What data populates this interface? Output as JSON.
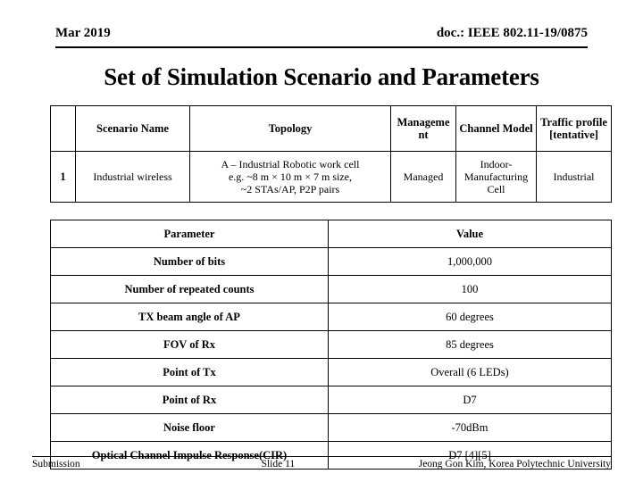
{
  "header": {
    "date": "Mar 2019",
    "doc": "doc.: IEEE 802.11-19/0875"
  },
  "title": "Set of Simulation Scenario and Parameters",
  "scenario_table": {
    "headers": [
      "",
      "Scenario Name",
      "Topology",
      "Manageme nt",
      "Channel Model",
      "Traffic profile [tentative]"
    ],
    "rows": [
      {
        "index": "1",
        "scenario_name": "Industrial wireless",
        "topology": "A – Industrial Robotic work cell\ne.g. ~8 m × 10 m × 7 m size,\n~2 STAs/AP, P2P pairs",
        "management": "Managed",
        "channel_model": "Indoor-Manufacturing Cell",
        "traffic_profile": "Industrial"
      }
    ]
  },
  "param_table": {
    "headers": [
      "Parameter",
      "Value"
    ],
    "rows": [
      {
        "parameter": "Number of bits",
        "value": "1,000,000"
      },
      {
        "parameter": "Number of repeated counts",
        "value": "100"
      },
      {
        "parameter": "TX beam angle of AP",
        "value": "60 degrees"
      },
      {
        "parameter": "FOV of Rx",
        "value": "85 degrees"
      },
      {
        "parameter": "Point of Tx",
        "value": "Overall (6 LEDs)"
      },
      {
        "parameter": "Point of Rx",
        "value": "D7"
      },
      {
        "parameter": "Noise floor",
        "value": "-70dBm"
      },
      {
        "parameter": "Optical Channel Impulse Response(CIR)",
        "value": "D7 [4][5]"
      }
    ]
  },
  "footer": {
    "left": "Submission",
    "center": "Slide 11",
    "right": "Jeong Gon Kim, Korea Polytechnic University"
  }
}
